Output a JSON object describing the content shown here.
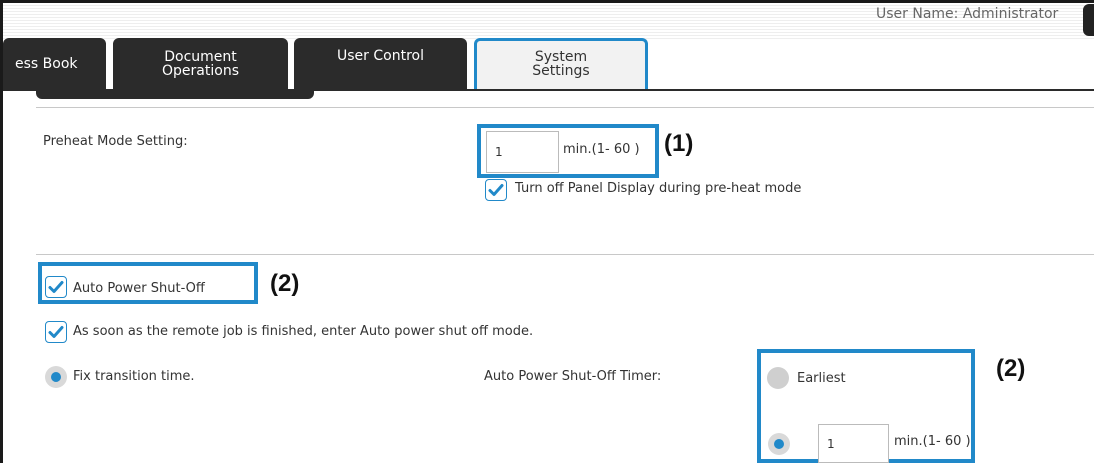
{
  "header": {
    "user_name": "User Name: Administrator"
  },
  "tabs": [
    {
      "label": "ess Book"
    },
    {
      "label_line1": "Document",
      "label_line2": "Operations"
    },
    {
      "label": "User Control"
    },
    {
      "label_line1": "System",
      "label_line2": "Settings",
      "active": true
    }
  ],
  "preheat": {
    "label": "Preheat Mode Setting:",
    "value": "1",
    "unit": "min.(1- 60 )",
    "panel_off_label": "Turn off Panel Display during pre-heat mode",
    "panel_off_checked": true
  },
  "auto_power": {
    "label": "Auto Power Shut-Off",
    "checked": true,
    "remote_job_label": "As soon as the remote job is finished, enter Auto power shut off mode.",
    "remote_job_checked": true,
    "fix_transition_label": "Fix transition time.",
    "fix_transition_selected": true,
    "timer_label": "Auto Power Shut-Off Timer:",
    "earliest_label": "Earliest",
    "earliest_selected": false,
    "custom_selected": true,
    "timer_value": "1",
    "timer_unit": "min.(1- 60 )"
  },
  "callouts": {
    "one": "(1)",
    "two": "(2)"
  },
  "colors": {
    "accent": "#2189c9",
    "tab_dark": "#2b2b2b",
    "tab_active": "#f2f2f2"
  }
}
